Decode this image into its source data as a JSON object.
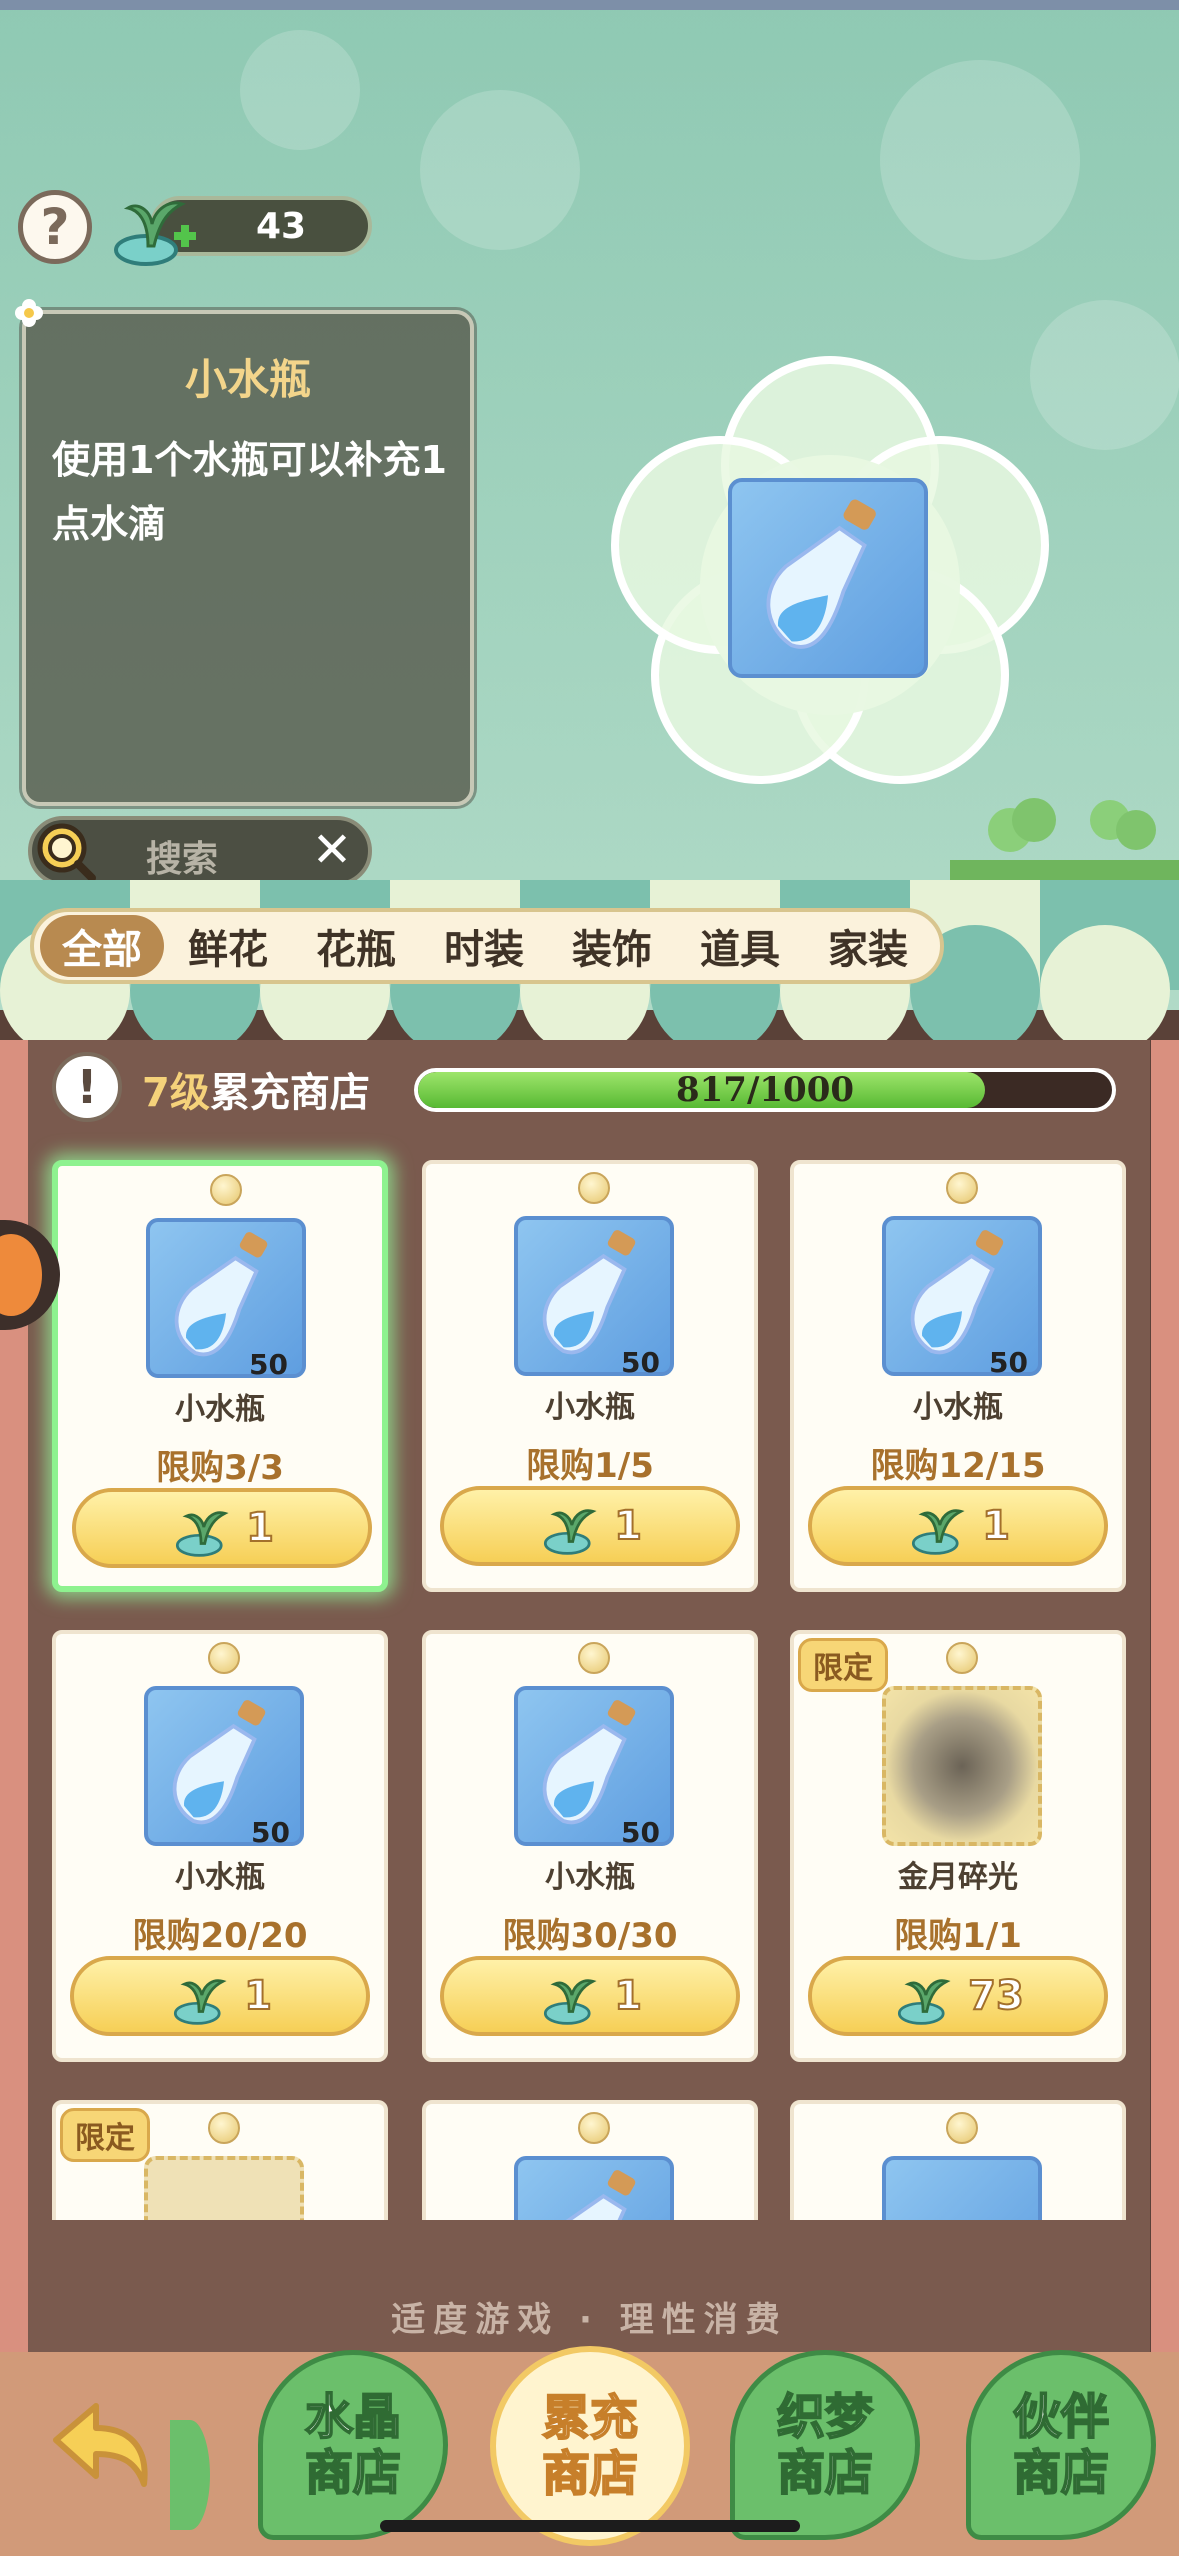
{
  "currency": {
    "amount": "43"
  },
  "preview": {
    "title": "小水瓶",
    "description": "使用1个水瓶可以补充1点水滴"
  },
  "search": {
    "placeholder": "搜索"
  },
  "tabs": [
    {
      "label": "全部",
      "active": true
    },
    {
      "label": "鲜花",
      "active": false
    },
    {
      "label": "花瓶",
      "active": false
    },
    {
      "label": "时装",
      "active": false
    },
    {
      "label": "装饰",
      "active": false
    },
    {
      "label": "道具",
      "active": false
    },
    {
      "label": "家装",
      "active": false
    }
  ],
  "shop": {
    "level_num": "7级",
    "level_name": "累充商店",
    "progress_text": "817/1000",
    "progress_fraction": 0.817
  },
  "items": [
    {
      "name": "小水瓶",
      "qty": "50",
      "limit": "限购3/3",
      "price": "1",
      "badge": "",
      "img": "bottle"
    },
    {
      "name": "小水瓶",
      "qty": "50",
      "limit": "限购1/5",
      "price": "1",
      "badge": "",
      "img": "bottle"
    },
    {
      "name": "小水瓶",
      "qty": "50",
      "limit": "限购12/15",
      "price": "1",
      "badge": "",
      "img": "bottle"
    },
    {
      "name": "小水瓶",
      "qty": "50",
      "limit": "限购20/20",
      "price": "1",
      "badge": "",
      "img": "bottle"
    },
    {
      "name": "小水瓶",
      "qty": "50",
      "limit": "限购30/30",
      "price": "1",
      "badge": "",
      "img": "bottle"
    },
    {
      "name": "金月碎光",
      "qty": "",
      "limit": "限购1/1",
      "price": "73",
      "badge": "限定",
      "img": "gold"
    },
    {
      "name": "",
      "qty": "",
      "limit": "",
      "price": "",
      "badge": "限定",
      "img": "scroll"
    },
    {
      "name": "",
      "qty": "",
      "limit": "",
      "price": "",
      "badge": "",
      "img": "bottle"
    },
    {
      "name": "",
      "qty": "",
      "limit": "",
      "price": "",
      "badge": "",
      "img": "feather"
    }
  ],
  "footer": {
    "slogan": "适度游戏 · 理性消费",
    "nav": [
      {
        "line1": "水晶",
        "line2": "商店"
      },
      {
        "line1": "累充",
        "line2": "商店"
      },
      {
        "line1": "织梦",
        "line2": "商店"
      },
      {
        "line1": "伙伴",
        "line2": "商店"
      }
    ]
  }
}
